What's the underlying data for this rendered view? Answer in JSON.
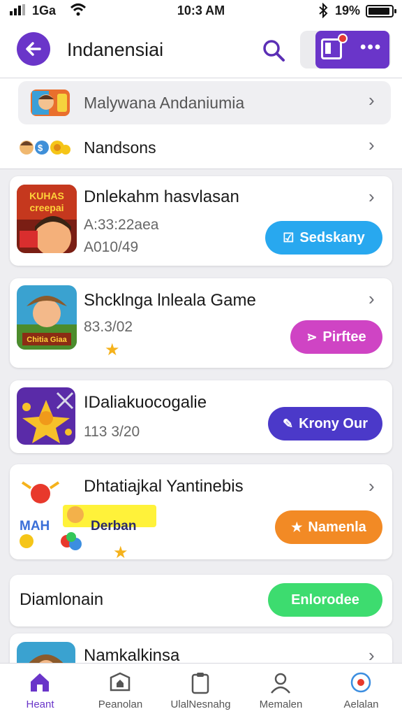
{
  "status_bar": {
    "carrier": "1Ga",
    "time": "10:3 AM",
    "battery": "19%"
  },
  "header": {
    "title": "Indanensiai"
  },
  "top_list": [
    {
      "label": "Malywana Andaniumia"
    },
    {
      "label": "Nandsons"
    }
  ],
  "cards": [
    {
      "title": "Dnlekahm hasvlasan",
      "meta1": "A:33:22aea",
      "meta2": "A010/49",
      "button": "Sedskany",
      "button_color": "#28a8ef",
      "thumb_text": "KUHAS creepai"
    },
    {
      "title": "Shcklnga lnleala Game",
      "meta1": "83.3/02",
      "button": "Pirftee",
      "button_color": "#cf44c4",
      "thumb_text": "Chitia Giaa"
    },
    {
      "title": "IDaliakuocogalie",
      "meta1": "113 3/20",
      "button": "Krony Our",
      "button_color": "#4b39c9"
    },
    {
      "title": "Dhtatiajkal Yantinebis",
      "banner_left": "MAH",
      "banner_right": "Derban",
      "button": "Namenla",
      "button_color": "#f28a25"
    },
    {
      "title": "Diamlonain",
      "button": "Enlorodee",
      "button_color": "#3ddc6f"
    },
    {
      "title": "Namkalkinsa"
    }
  ],
  "bottom_nav": [
    {
      "label": "Heant",
      "icon": "home-icon"
    },
    {
      "label": "Peanolan",
      "icon": "box-icon"
    },
    {
      "label": "UlalNesnahg",
      "icon": "clipboard-icon"
    },
    {
      "label": "Memalen",
      "icon": "user-icon"
    },
    {
      "label": "Aelalan",
      "icon": "globe-icon"
    }
  ],
  "colors": {
    "accent": "#6a35c9",
    "background": "#eeeef1"
  }
}
